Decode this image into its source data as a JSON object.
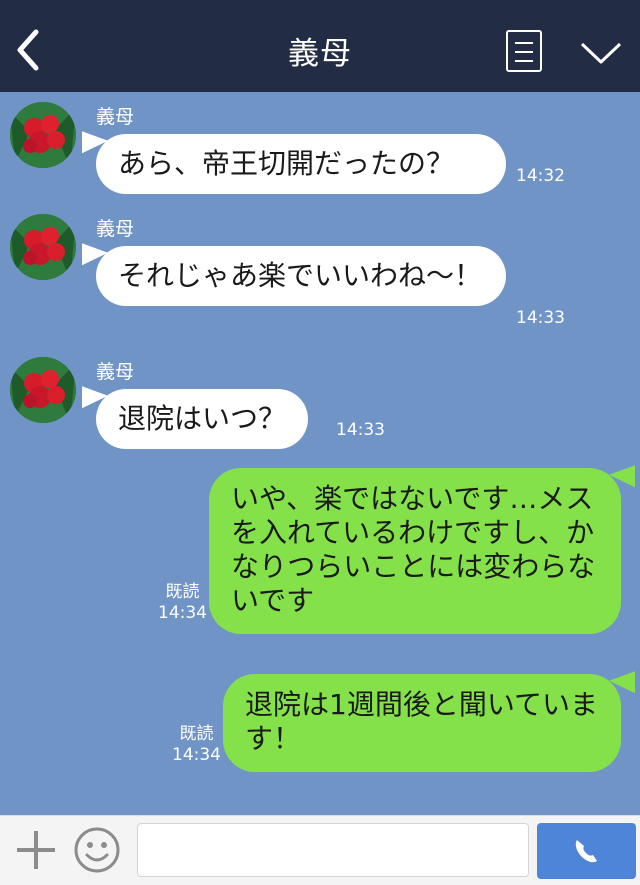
{
  "header": {
    "title": "義母",
    "back_icon": "chevron-left-icon",
    "menu_icon": "menu-list-icon",
    "dropdown_icon": "chevron-down-icon"
  },
  "messages": [
    {
      "side": "left",
      "sender": "義母",
      "text": "あら、帝王切開だったの？",
      "time": "14:32"
    },
    {
      "side": "left",
      "sender": "義母",
      "text": "それじゃあ楽でいいわね〜！",
      "time": "14:33"
    },
    {
      "side": "left",
      "sender": "義母",
      "text": "退院はいつ？",
      "time": "14:33"
    },
    {
      "side": "right",
      "read": "既読",
      "text": "いや、楽ではないです…メスを入れているわけですし、かなりつらいことには変わらないです",
      "time": "14:34"
    },
    {
      "side": "right",
      "read": "既読",
      "text": "退院は1週間後と聞いています！",
      "time": "14:34"
    }
  ],
  "footer": {
    "plus_icon": "plus-icon",
    "emoji_icon": "smiley-icon",
    "input_value": "",
    "call_icon": "phone-icon"
  },
  "colors": {
    "header_bg": "#232c45",
    "chat_bg": "#7194c6",
    "own_bubble": "#85e149",
    "other_bubble": "#ffffff",
    "call_button": "#4e85d8"
  }
}
